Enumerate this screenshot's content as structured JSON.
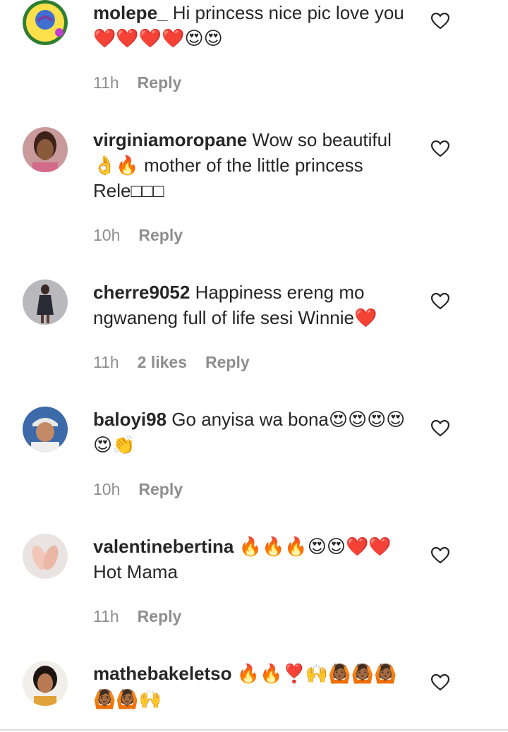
{
  "comments": [
    {
      "username": "molepe_",
      "text": " Hi princess nice pic love you ❤️❤️❤️❤️😍😍",
      "time": "11h",
      "likes": "",
      "reply": "Reply",
      "avatar": "vaccination-badge-avatar"
    },
    {
      "username": "virginiamoropane",
      "text": " Wow so beautiful 👌🔥 mother of the little princess Rele□□□",
      "time": "10h",
      "likes": "",
      "reply": "Reply",
      "avatar": "woman-portrait-avatar"
    },
    {
      "username": "cherre9052",
      "text": " Happiness ereng mo ngwaneng full of life sesi Winnie❤️",
      "time": "11h",
      "likes": "2 likes",
      "reply": "Reply",
      "avatar": "person-standing-avatar"
    },
    {
      "username": "baloyi98",
      "text": " Go anyisa wa bona😍😍😍😍😍👏",
      "time": "10h",
      "likes": "",
      "reply": "Reply",
      "avatar": "woman-cap-avatar"
    },
    {
      "username": "valentinebertina",
      "text": " 🔥🔥🔥😍😍❤️❤️Hot Mama",
      "time": "11h",
      "likes": "",
      "reply": "Reply",
      "avatar": "baby-feet-avatar"
    },
    {
      "username": "mathebakeletso",
      "text": " 🔥🔥❣️🙌🙆🏾🙆🏾🙆🏾🙆🏾🙆🏾🙌",
      "time": "",
      "likes": "",
      "reply": "",
      "avatar": "woman-selfie-avatar"
    }
  ],
  "colors": {
    "text": "#262626",
    "meta": "#8e8e8e",
    "divider": "#dbdbdb"
  },
  "icons": {
    "like": "heart-outline-icon"
  }
}
